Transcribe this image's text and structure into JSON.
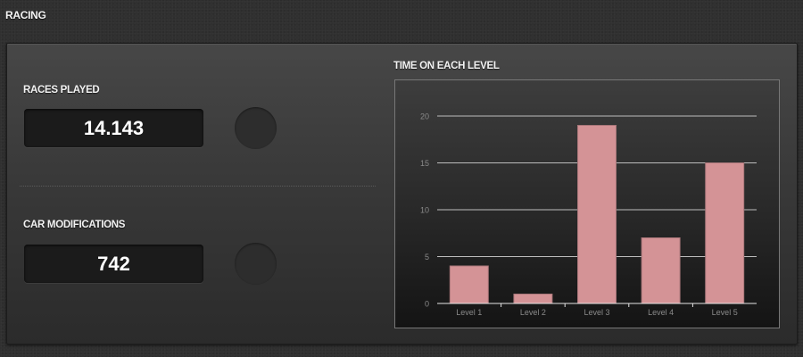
{
  "header": {
    "title": "RACING"
  },
  "stats": [
    {
      "label": "RACES PLAYED",
      "value": "14.143"
    },
    {
      "label": "CAR MODIFICATIONS",
      "value": "742"
    }
  ],
  "chart": {
    "title": "TIME ON EACH LEVEL"
  },
  "colors": {
    "bar": "#d49396",
    "grid": "#bdbdbd",
    "tick_label": "#8a8a8a"
  },
  "chart_data": {
    "type": "bar",
    "title": "TIME ON EACH LEVEL",
    "categories": [
      "Level 1",
      "Level 2",
      "Level 3",
      "Level 4",
      "Level 5"
    ],
    "values": [
      4,
      1,
      19,
      7,
      15
    ],
    "yticks": [
      0,
      5,
      10,
      15,
      20
    ],
    "ylim": [
      0,
      20
    ],
    "xlabel": "",
    "ylabel": "",
    "grid": true
  }
}
